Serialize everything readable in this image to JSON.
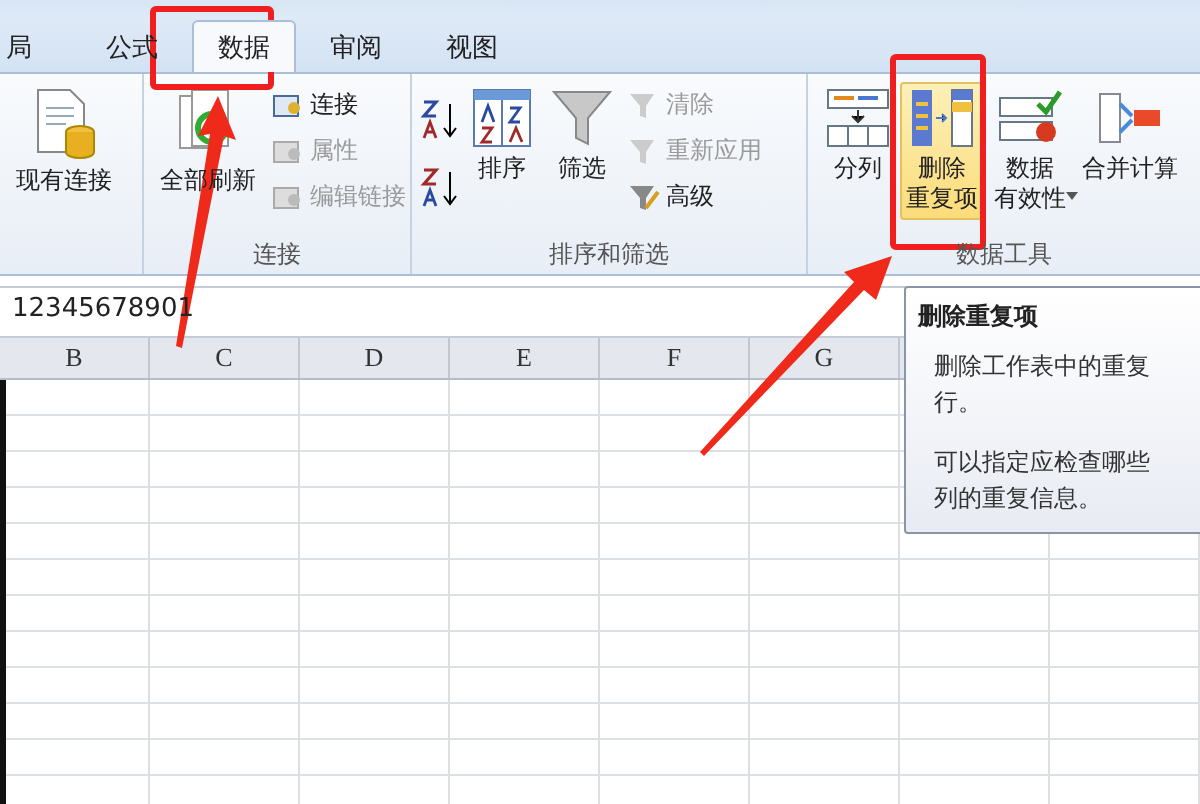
{
  "tabs": [
    {
      "label": "局",
      "selected": false
    },
    {
      "label": "公式",
      "selected": false
    },
    {
      "label": "数据",
      "selected": true
    },
    {
      "label": "审阅",
      "selected": false
    },
    {
      "label": "视图",
      "selected": false
    }
  ],
  "ribbon": {
    "existing_connections": {
      "label": "现有连接"
    },
    "connections": {
      "label": "连接",
      "refresh_all": "全部刷新",
      "items": [
        {
          "label": "连接",
          "disabled": false
        },
        {
          "label": "属性",
          "disabled": true
        },
        {
          "label": "编辑链接",
          "disabled": true
        }
      ]
    },
    "sort_filter": {
      "label": "排序和筛选",
      "sort": "排序",
      "filter": "筛选",
      "items": [
        {
          "label": "清除",
          "disabled": true
        },
        {
          "label": "重新应用",
          "disabled": true
        },
        {
          "label": "高级",
          "disabled": false
        }
      ]
    },
    "data_tools": {
      "label": "数据工具",
      "buttons": [
        {
          "lines": [
            "分列"
          ],
          "highlighted": false
        },
        {
          "lines": [
            "删除",
            "重复项"
          ],
          "highlighted": true
        },
        {
          "lines": [
            "数据",
            "有效性"
          ],
          "highlighted": false
        },
        {
          "lines": [
            "合并计算"
          ],
          "highlighted": false
        }
      ]
    }
  },
  "formula_bar": {
    "value": "12345678901"
  },
  "columns": [
    "B",
    "C",
    "D",
    "E",
    "F",
    "G"
  ],
  "tooltip": {
    "title": "删除重复项",
    "paragraphs": [
      "删除工作表中的重复行。",
      "可以指定应检查哪些列的重复信息。"
    ]
  }
}
